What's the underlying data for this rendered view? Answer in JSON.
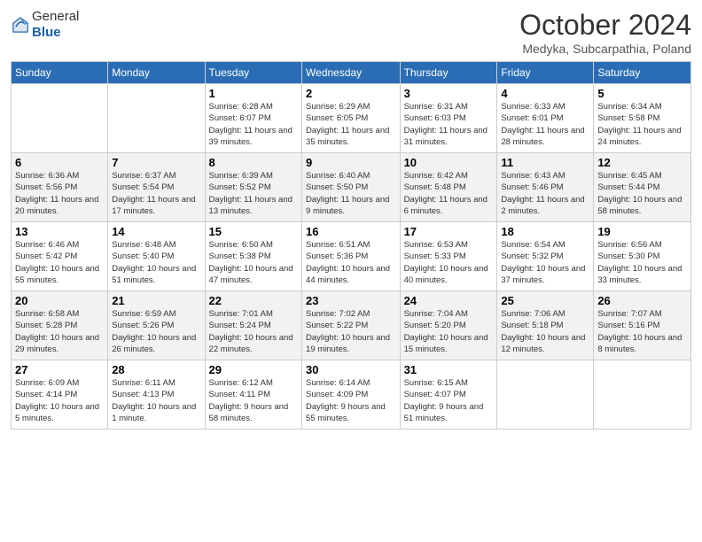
{
  "header": {
    "logo_general": "General",
    "logo_blue": "Blue",
    "month_title": "October 2024",
    "subtitle": "Medyka, Subcarpathia, Poland"
  },
  "days_of_week": [
    "Sunday",
    "Monday",
    "Tuesday",
    "Wednesday",
    "Thursday",
    "Friday",
    "Saturday"
  ],
  "weeks": [
    [
      {
        "day": "",
        "info": ""
      },
      {
        "day": "",
        "info": ""
      },
      {
        "day": "1",
        "info": "Sunrise: 6:28 AM\nSunset: 6:07 PM\nDaylight: 11 hours and 39 minutes."
      },
      {
        "day": "2",
        "info": "Sunrise: 6:29 AM\nSunset: 6:05 PM\nDaylight: 11 hours and 35 minutes."
      },
      {
        "day": "3",
        "info": "Sunrise: 6:31 AM\nSunset: 6:03 PM\nDaylight: 11 hours and 31 minutes."
      },
      {
        "day": "4",
        "info": "Sunrise: 6:33 AM\nSunset: 6:01 PM\nDaylight: 11 hours and 28 minutes."
      },
      {
        "day": "5",
        "info": "Sunrise: 6:34 AM\nSunset: 5:58 PM\nDaylight: 11 hours and 24 minutes."
      }
    ],
    [
      {
        "day": "6",
        "info": "Sunrise: 6:36 AM\nSunset: 5:56 PM\nDaylight: 11 hours and 20 minutes."
      },
      {
        "day": "7",
        "info": "Sunrise: 6:37 AM\nSunset: 5:54 PM\nDaylight: 11 hours and 17 minutes."
      },
      {
        "day": "8",
        "info": "Sunrise: 6:39 AM\nSunset: 5:52 PM\nDaylight: 11 hours and 13 minutes."
      },
      {
        "day": "9",
        "info": "Sunrise: 6:40 AM\nSunset: 5:50 PM\nDaylight: 11 hours and 9 minutes."
      },
      {
        "day": "10",
        "info": "Sunrise: 6:42 AM\nSunset: 5:48 PM\nDaylight: 11 hours and 6 minutes."
      },
      {
        "day": "11",
        "info": "Sunrise: 6:43 AM\nSunset: 5:46 PM\nDaylight: 11 hours and 2 minutes."
      },
      {
        "day": "12",
        "info": "Sunrise: 6:45 AM\nSunset: 5:44 PM\nDaylight: 10 hours and 58 minutes."
      }
    ],
    [
      {
        "day": "13",
        "info": "Sunrise: 6:46 AM\nSunset: 5:42 PM\nDaylight: 10 hours and 55 minutes."
      },
      {
        "day": "14",
        "info": "Sunrise: 6:48 AM\nSunset: 5:40 PM\nDaylight: 10 hours and 51 minutes."
      },
      {
        "day": "15",
        "info": "Sunrise: 6:50 AM\nSunset: 5:38 PM\nDaylight: 10 hours and 47 minutes."
      },
      {
        "day": "16",
        "info": "Sunrise: 6:51 AM\nSunset: 5:36 PM\nDaylight: 10 hours and 44 minutes."
      },
      {
        "day": "17",
        "info": "Sunrise: 6:53 AM\nSunset: 5:33 PM\nDaylight: 10 hours and 40 minutes."
      },
      {
        "day": "18",
        "info": "Sunrise: 6:54 AM\nSunset: 5:32 PM\nDaylight: 10 hours and 37 minutes."
      },
      {
        "day": "19",
        "info": "Sunrise: 6:56 AM\nSunset: 5:30 PM\nDaylight: 10 hours and 33 minutes."
      }
    ],
    [
      {
        "day": "20",
        "info": "Sunrise: 6:58 AM\nSunset: 5:28 PM\nDaylight: 10 hours and 29 minutes."
      },
      {
        "day": "21",
        "info": "Sunrise: 6:59 AM\nSunset: 5:26 PM\nDaylight: 10 hours and 26 minutes."
      },
      {
        "day": "22",
        "info": "Sunrise: 7:01 AM\nSunset: 5:24 PM\nDaylight: 10 hours and 22 minutes."
      },
      {
        "day": "23",
        "info": "Sunrise: 7:02 AM\nSunset: 5:22 PM\nDaylight: 10 hours and 19 minutes."
      },
      {
        "day": "24",
        "info": "Sunrise: 7:04 AM\nSunset: 5:20 PM\nDaylight: 10 hours and 15 minutes."
      },
      {
        "day": "25",
        "info": "Sunrise: 7:06 AM\nSunset: 5:18 PM\nDaylight: 10 hours and 12 minutes."
      },
      {
        "day": "26",
        "info": "Sunrise: 7:07 AM\nSunset: 5:16 PM\nDaylight: 10 hours and 8 minutes."
      }
    ],
    [
      {
        "day": "27",
        "info": "Sunrise: 6:09 AM\nSunset: 4:14 PM\nDaylight: 10 hours and 5 minutes."
      },
      {
        "day": "28",
        "info": "Sunrise: 6:11 AM\nSunset: 4:13 PM\nDaylight: 10 hours and 1 minute."
      },
      {
        "day": "29",
        "info": "Sunrise: 6:12 AM\nSunset: 4:11 PM\nDaylight: 9 hours and 58 minutes."
      },
      {
        "day": "30",
        "info": "Sunrise: 6:14 AM\nSunset: 4:09 PM\nDaylight: 9 hours and 55 minutes."
      },
      {
        "day": "31",
        "info": "Sunrise: 6:15 AM\nSunset: 4:07 PM\nDaylight: 9 hours and 51 minutes."
      },
      {
        "day": "",
        "info": ""
      },
      {
        "day": "",
        "info": ""
      }
    ]
  ]
}
